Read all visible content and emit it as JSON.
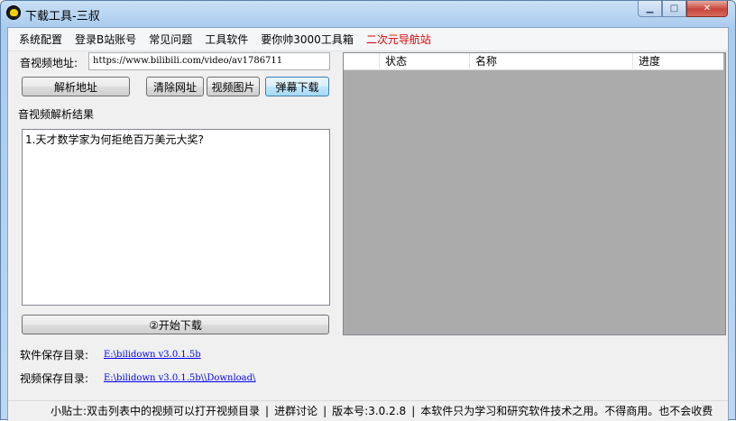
{
  "window": {
    "title": "下载工具-三叔",
    "minimize": "▁",
    "maximize": "□",
    "close": "✕"
  },
  "menu": {
    "items": [
      "系统配置",
      "登录B站账号",
      "常见问题",
      "工具软件",
      "要你帅3000工具箱",
      "二次元导航站"
    ]
  },
  "address": {
    "label": "音视频地址:",
    "value": "https://www.bilibili.com/video/av1786711"
  },
  "buttons": {
    "parse": "解析地址",
    "clear": "清除网址",
    "video_image": "视频图片",
    "danmaku": "弹幕下载",
    "start": "②开始下载"
  },
  "result": {
    "label": "音视频解析结果",
    "items": [
      "1.天才数学家为何拒绝百万美元大奖?"
    ]
  },
  "download_list": {
    "columns": [
      "",
      "状态",
      "名称",
      "进度"
    ]
  },
  "paths": {
    "software_label": "软件保存目录:",
    "software_value": "E:\\bilidown v3.0.1.5b",
    "video_label": "视频保存目录:",
    "video_value": "E:\\bilidown v3.0.1.5b\\\\Download\\"
  },
  "status": {
    "tip": "小贴士:双击列表中的视频可以打开视频目录",
    "discuss": "进群讨论",
    "version": "版本号:3.0.2.8",
    "notice": "本软件只为学习和研究软件技术之用。不得商用。也不会收费"
  }
}
